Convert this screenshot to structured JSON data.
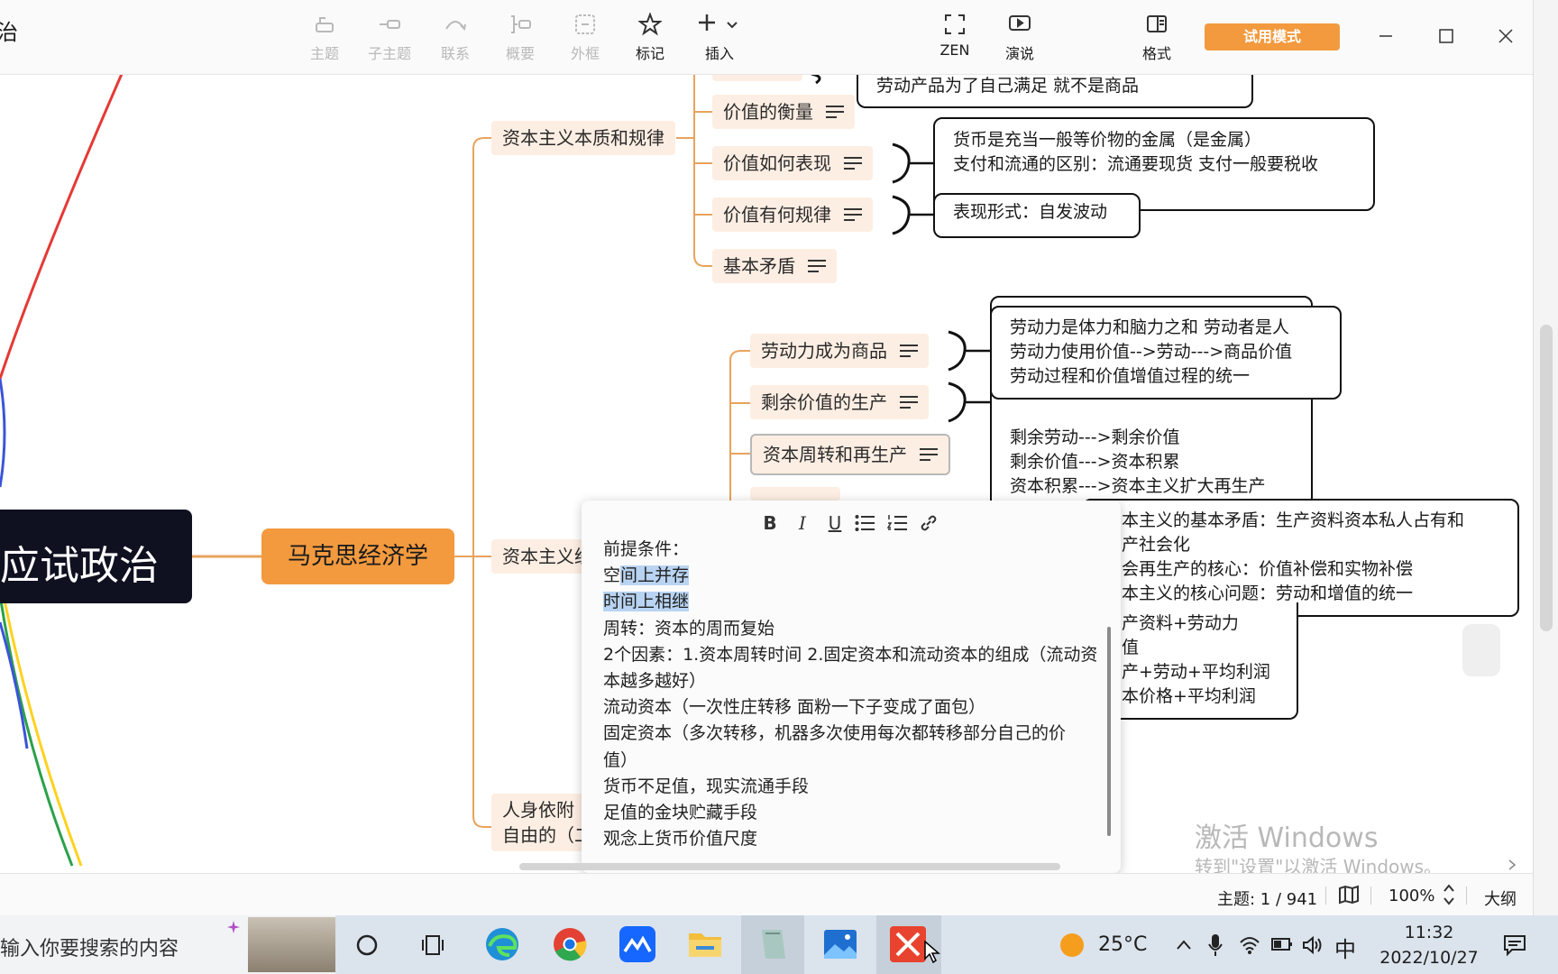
{
  "app": {
    "partial_title": "治"
  },
  "toolbar": {
    "items": [
      {
        "label": "主题",
        "icon": "topic-icon",
        "enabled": false
      },
      {
        "label": "子主题",
        "icon": "subtopic-icon",
        "enabled": false
      },
      {
        "label": "联系",
        "icon": "relationship-icon",
        "enabled": false
      },
      {
        "label": "概要",
        "icon": "summary-icon",
        "enabled": false
      },
      {
        "label": "外框",
        "icon": "boundary-icon",
        "enabled": false
      },
      {
        "label": "标记",
        "icon": "star-icon",
        "enabled": true
      },
      {
        "label": "插入",
        "icon": "plus-icon",
        "enabled": true
      },
      {
        "label": "ZEN",
        "icon": "zen-icon",
        "enabled": true
      },
      {
        "label": "演说",
        "icon": "pitch-icon",
        "enabled": true
      },
      {
        "label": "格式",
        "icon": "format-panel-icon",
        "enabled": true
      }
    ],
    "trial_label": "试用模式"
  },
  "mindmap": {
    "root_partial": "应试政治",
    "main_topic": "马克思经济学",
    "branches": {
      "essence": "资本主义本质和规律",
      "capital_partial": "资本主义经",
      "personal_line1": "人身依附",
      "personal_line2": "自由的（二"
    },
    "essence_children": [
      "价值的衡量",
      "价值如何表现",
      "价值有何规律",
      "基本矛盾"
    ],
    "capital_children": [
      "劳动力成为商品",
      "剩余价值的生产",
      "资本周转和再生产"
    ],
    "callouts": {
      "top": "劳动产品为了自己满足 就不是商品",
      "money": [
        "货币是充当一般等价物的金属（是金属）",
        "支付和流通的区别：流通要现货 支付一般要税收"
      ],
      "law": "表现形式：自发波动",
      "labor": [
        "劳动力是体力和脑力之和 劳动者是人",
        "劳动力使用价值-->劳动--->商品价值",
        "劳动过程和价值增值过程的统一"
      ],
      "surplus": [
        "剩余劳动--->剩余价值",
        "剩余价值--->资本积累",
        "资本积累--->资本主义扩大再生产"
      ],
      "contradiction": [
        "本主义的基本矛盾：生产资料资本私人占有和",
        "产社会化",
        "会再生产的核心：价值补偿和实物补偿",
        "本主义的核心问题：劳动和增值的统一"
      ],
      "price": [
        "产资料+劳动力",
        "值",
        "产+劳动+平均利润",
        "本价格+平均利润"
      ]
    }
  },
  "note_editor": {
    "format_buttons": [
      "B",
      "I",
      "U"
    ],
    "lines": [
      "前提条件：",
      "空间上并存",
      "时间上相继",
      "周转：资本的周而复始",
      "2个因素：1.资本周转时间 2.固定资本和流动资本的组成（流动资",
      "本越多越好）",
      "流动资本（一次性庄转移 面粉一下子变成了面包）",
      "固定资本（多次转移，机器多次使用每次都转移部分自己的价",
      "值）",
      "货币不足值，现实流通手段",
      "足值的金块贮藏手段",
      "观念上货币价值尺度"
    ]
  },
  "statusbar": {
    "topic_count": "主题: 1 / 941",
    "zoom": "100%",
    "outline_label": "大纲"
  },
  "watermark": {
    "line1": "激活 Windows",
    "line2": "转到\"设置\"以激活 Windows。"
  },
  "taskbar": {
    "search_placeholder": "输入你要搜索的内容",
    "weather": "25°C",
    "ime": "中",
    "time": "11:32",
    "date": "2022/10/27"
  },
  "colors": {
    "accent_orange": "#f39a3f",
    "node_bg": "#fdeee3",
    "line_orange": "#e8a35c",
    "root_bg": "#0f1020"
  }
}
